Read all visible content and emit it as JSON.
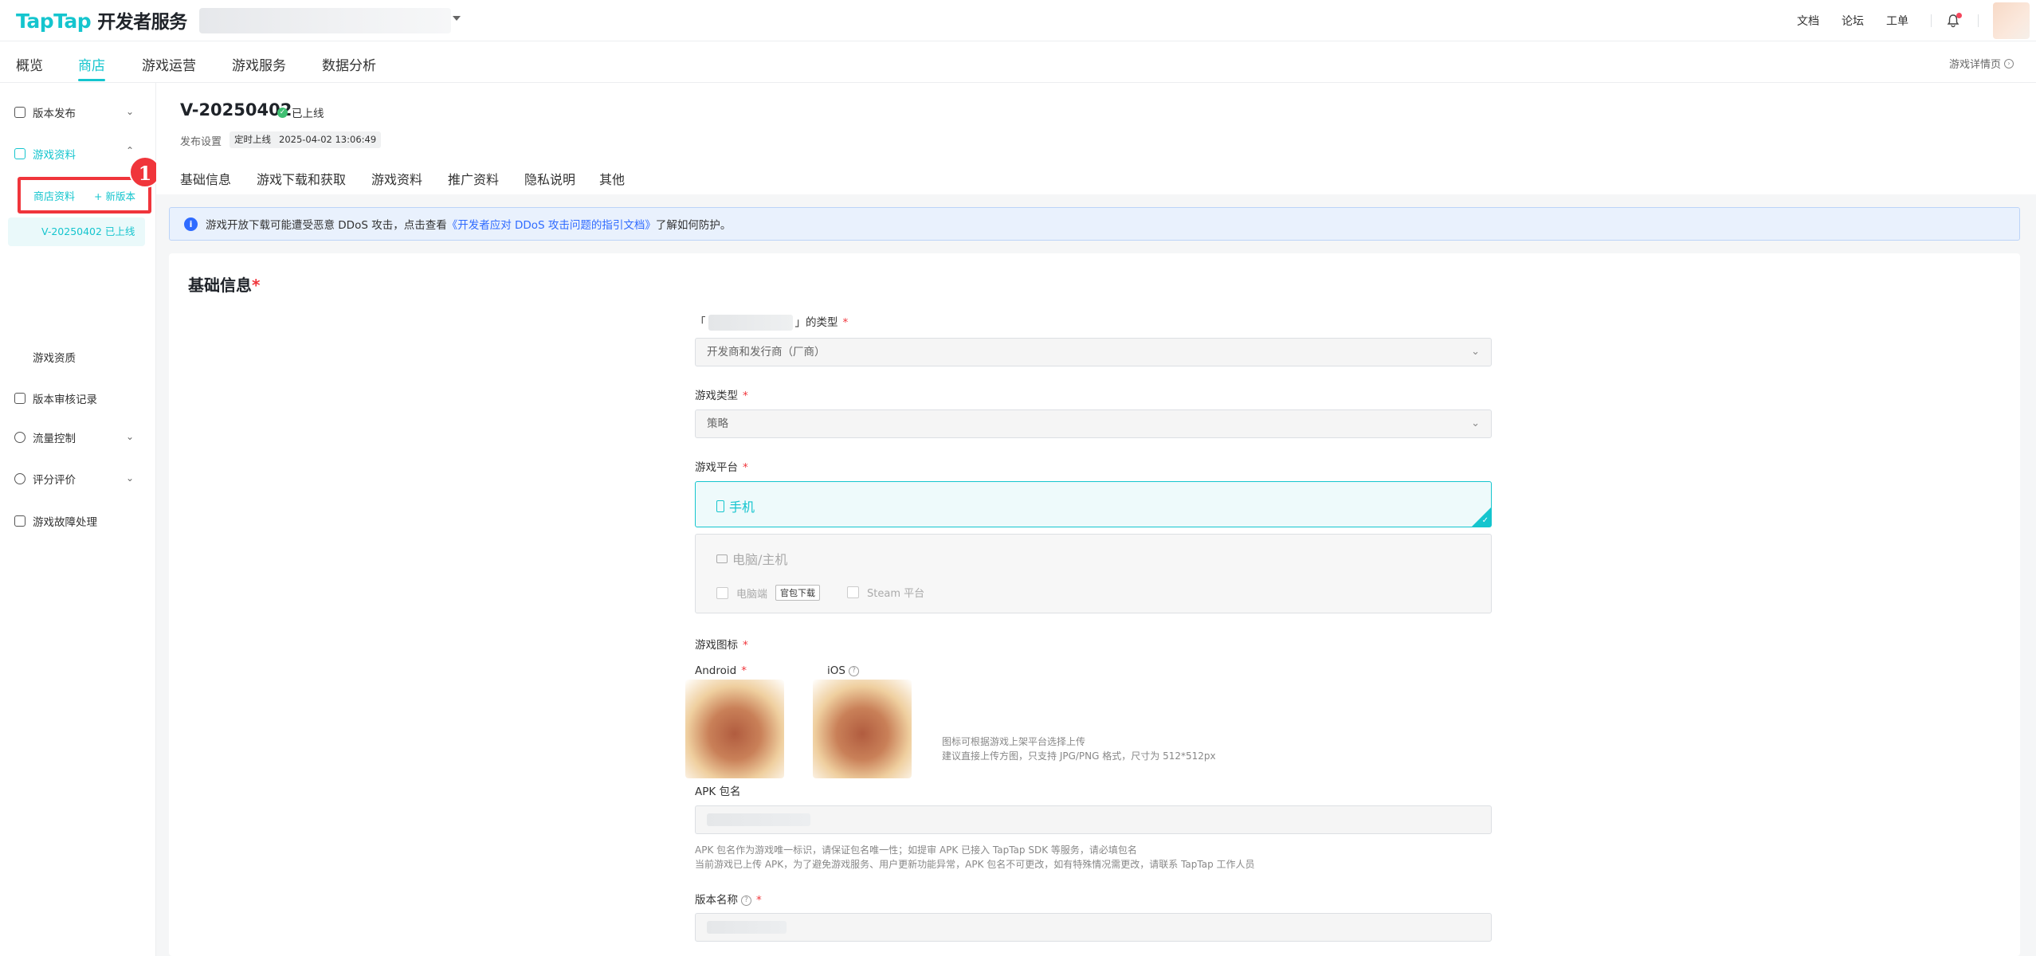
{
  "header": {
    "logo_en": "TapTap",
    "logo_cn": "开发者服务",
    "links": [
      "文档",
      "论坛",
      "工单"
    ]
  },
  "nav": {
    "tabs": [
      "概览",
      "商店",
      "游戏运营",
      "游戏服务",
      "数据分析"
    ],
    "active": "商店",
    "detail_link": "游戏详情页"
  },
  "sidebar": {
    "items": [
      {
        "label": "版本发布"
      },
      {
        "label": "游戏资料"
      },
      {
        "label": "游戏资质"
      },
      {
        "label": "版本审核记录"
      },
      {
        "label": "流量控制"
      },
      {
        "label": "评分评价"
      },
      {
        "label": "游戏故障处理"
      }
    ],
    "store_info": "商店资料",
    "new_version": "+ 新版本",
    "version_entry": "V-20250402 已上线"
  },
  "annotation": {
    "badge": "1"
  },
  "version": {
    "title": "V-20250402",
    "status": "已上线",
    "publish_label": "发布设置",
    "publish_mode": "定时上线",
    "publish_time": "2025-04-02 13:06:49"
  },
  "subtabs": [
    "基础信息",
    "游戏下载和获取",
    "游戏资料",
    "推广资料",
    "隐私说明",
    "其他"
  ],
  "notice": {
    "pre": "游戏开放下载可能遭受恶意 DDoS 攻击，点击查看",
    "link": "《开发者应对 DDoS 攻击问题的指引文档》",
    "post": "了解如何防护。"
  },
  "form": {
    "section_title": "基础信息",
    "type_label_open": "「",
    "type_label_close": "」的类型",
    "type_value": "开发商和发行商（厂商）",
    "game_type_label": "游戏类型",
    "game_type_value": "策略",
    "platform_label": "游戏平台",
    "platform_mobile": "手机",
    "platform_pc": "电脑/主机",
    "pc_option": "电脑端",
    "pc_option_chip": "官包下载",
    "steam_option": "Steam 平台",
    "icon_label": "游戏图标",
    "android_label": "Android",
    "ios_label": "iOS",
    "icon_hint_1": "图标可根据游戏上架平台选择上传",
    "icon_hint_2": "建议直接上传方图，只支持 JPG/PNG 格式，尺寸为 512*512px",
    "apk_label": "APK 包名",
    "apk_hint_1": "APK 包名作为游戏唯一标识，请保证包名唯一性；如提审 APK 已接入 TapTap SDK 等服务，请必填包名",
    "apk_hint_2": "当前游戏已上传 APK，为了避免游戏服务、用户更新功能异常，APK 包名不可更改，如有特殊情况需更改，请联系 TapTap 工作人员",
    "version_name_label": "版本名称"
  }
}
